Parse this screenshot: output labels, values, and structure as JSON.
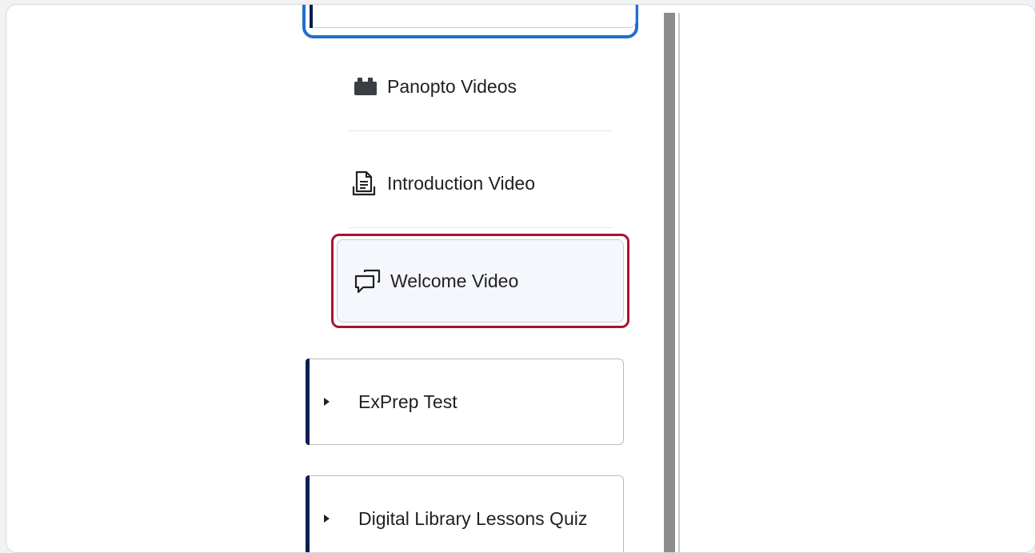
{
  "sidebar": {
    "items": [
      {
        "label": "Panopto Videos",
        "icon": "lego-block-icon"
      },
      {
        "label": "Introduction Video",
        "icon": "document-icon"
      },
      {
        "label": "Welcome Video",
        "icon": "discussion-icon",
        "selected": true
      }
    ],
    "modules": [
      {
        "label": "ExPrep Test"
      },
      {
        "label": "Digital Library Lessons Quiz"
      }
    ]
  },
  "colors": {
    "highlight": "#a8142e",
    "focus": "#1f6fd0",
    "module_bar": "#0b1e52"
  }
}
